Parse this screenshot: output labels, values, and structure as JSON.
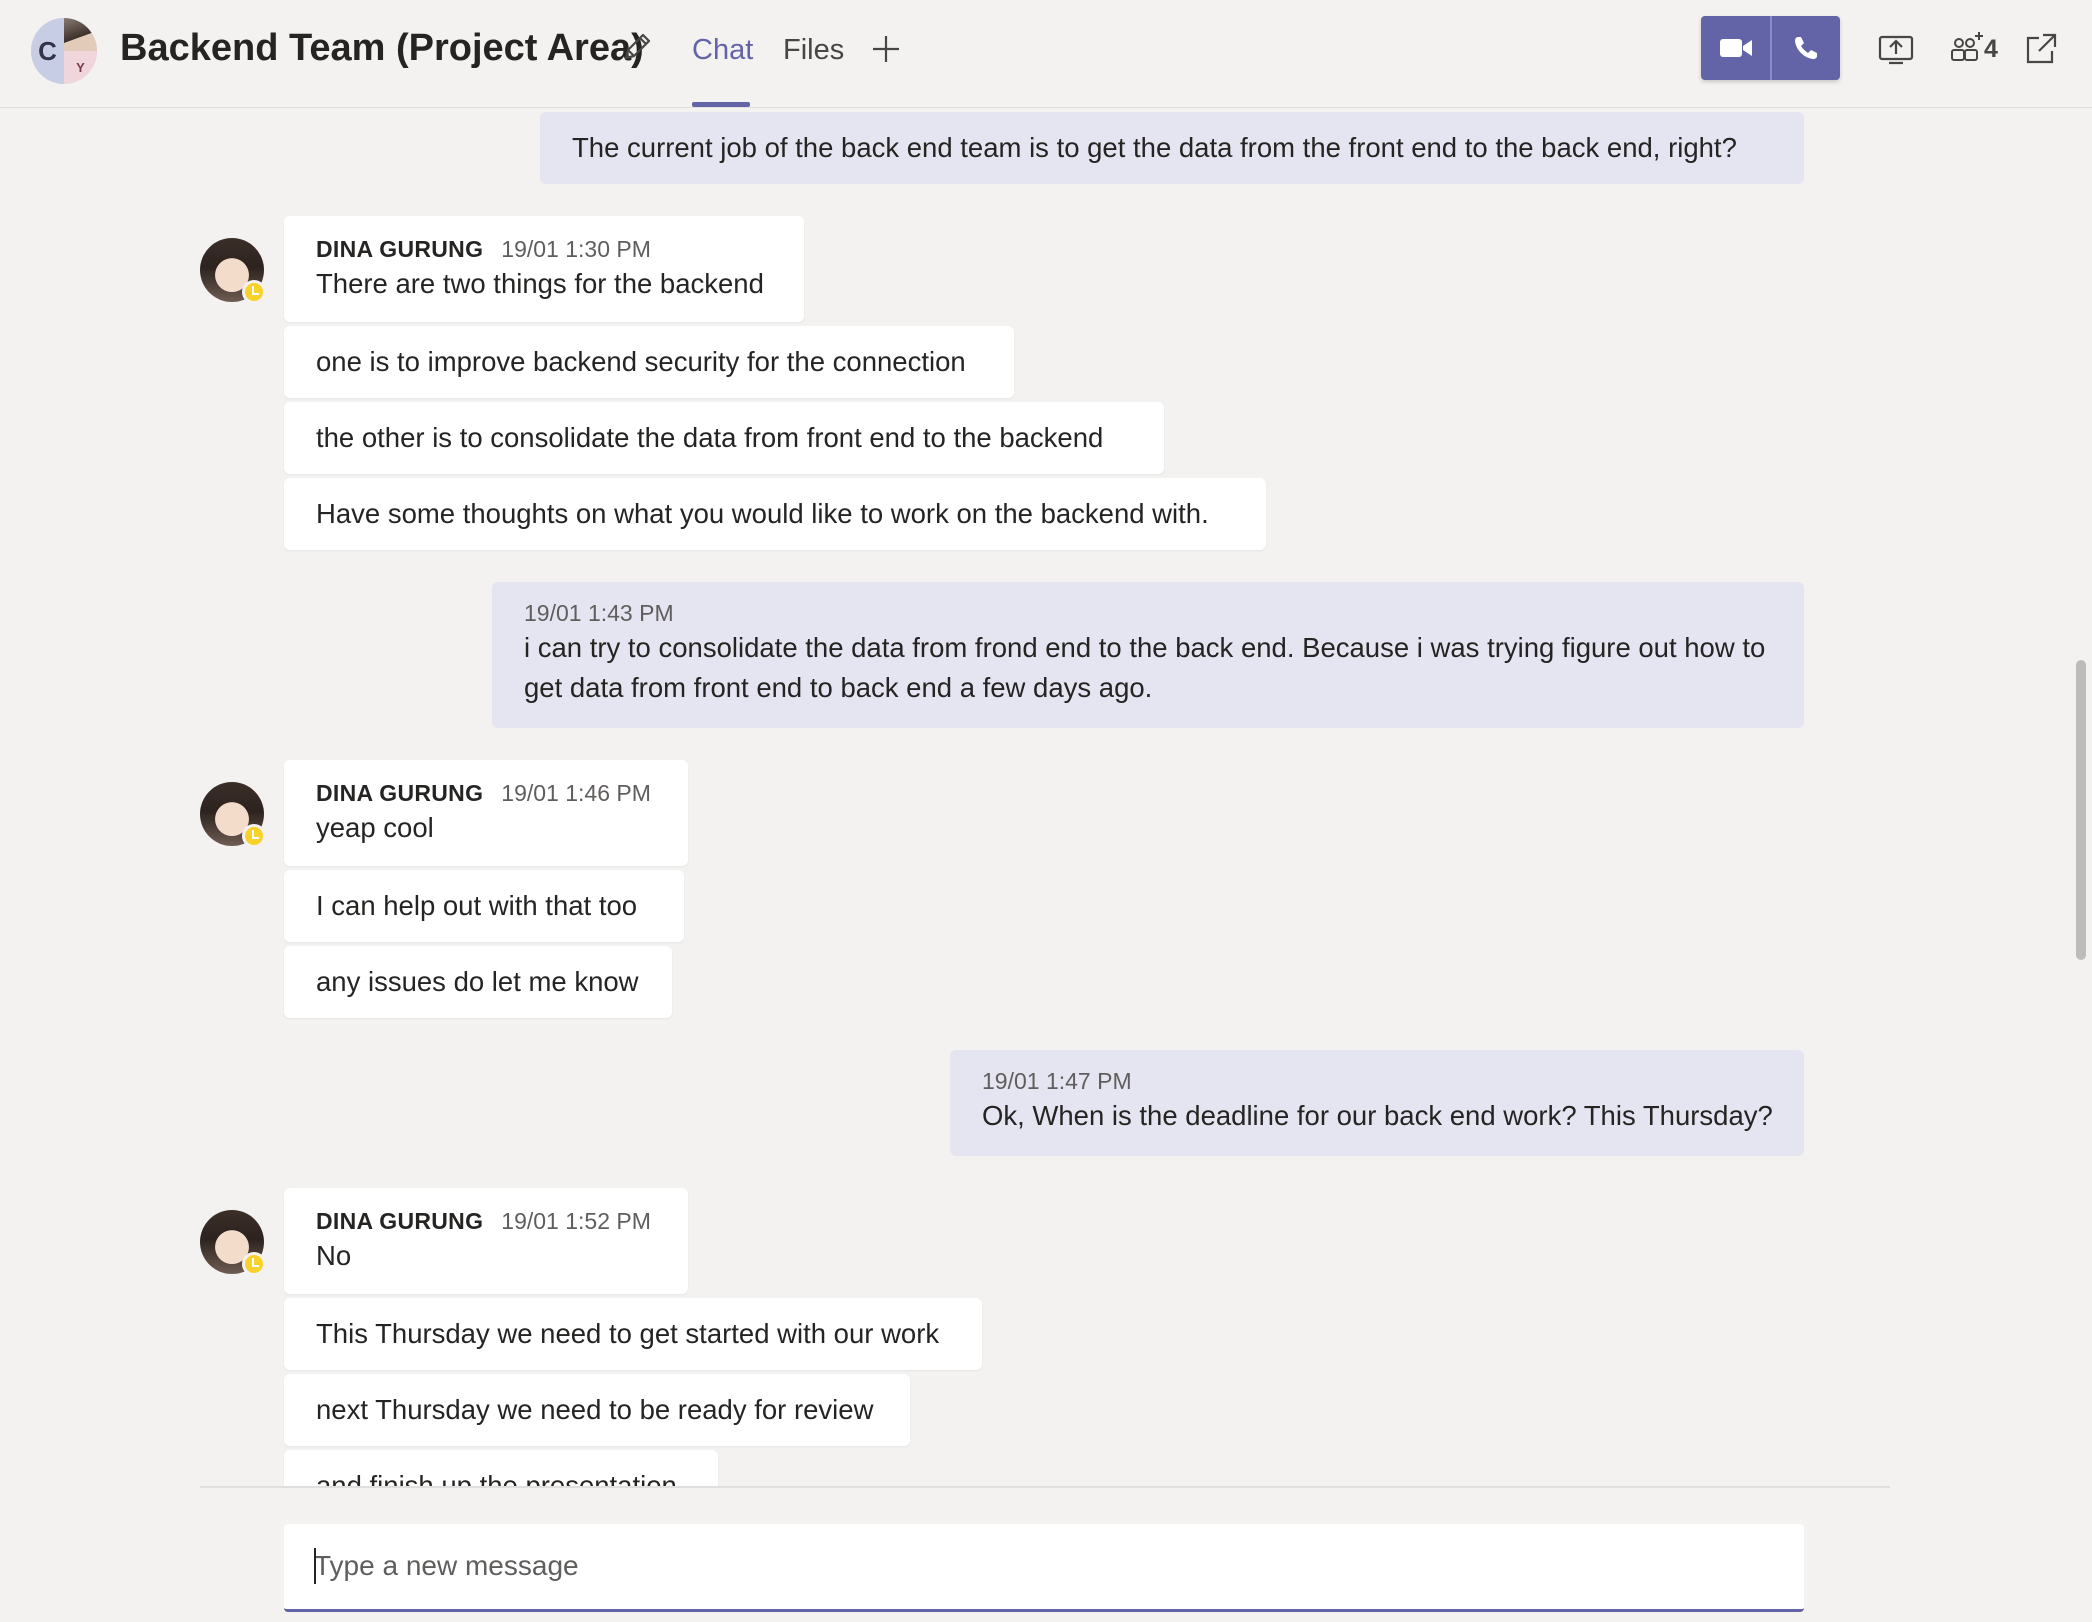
{
  "header": {
    "title": "Backend Team (Project Area)",
    "avatar_initial": "C",
    "avatar_sub_initial": "Y",
    "tabs": [
      {
        "label": "Chat",
        "active": true
      },
      {
        "label": "Files",
        "active": false
      }
    ],
    "participant_count": "4",
    "accent_color": "#6264a7"
  },
  "icons": {
    "edit": "pencil-icon",
    "add_tab": "plus-icon",
    "video_call": "video-camera-icon",
    "audio_call": "phone-icon",
    "share": "share-screen-icon",
    "participants": "add-people-icon",
    "pop_out": "pop-out-icon"
  },
  "messages": [
    {
      "id": "m1",
      "sent_by_me": true,
      "text": "The current job of the back end team is to get the data from the front end to the back end, right?"
    },
    {
      "id": "g1",
      "sent_by_me": false,
      "author": "DINA GURUNG",
      "time": "19/01 1:30 PM",
      "texts": [
        "There are two things for the backend",
        "one is to improve backend security for the connection",
        "the other is to consolidate the data from front end to the backend",
        "Have some thoughts on what you would like to work on the backend with."
      ]
    },
    {
      "id": "m2",
      "sent_by_me": true,
      "time": "19/01 1:43 PM",
      "text": "i can try to consolidate the data from frond end to the back end. Because i was trying figure out how to get data from front end to back end a few days ago."
    },
    {
      "id": "g2",
      "sent_by_me": false,
      "author": "DINA GURUNG",
      "time": "19/01 1:46 PM",
      "texts": [
        "yeap cool",
        "I can help out with that too",
        "any issues do let me know"
      ]
    },
    {
      "id": "m3",
      "sent_by_me": true,
      "time": "19/01 1:47 PM",
      "text": "Ok, When is the deadline for our back end work? This Thursday?"
    },
    {
      "id": "g3",
      "sent_by_me": false,
      "author": "DINA GURUNG",
      "time": "19/01 1:52 PM",
      "texts": [
        "No",
        "This Thursday we need to get started with our work",
        "next Thursday we need to be ready for review",
        "and finish up the presentation"
      ]
    }
  ],
  "compose": {
    "placeholder": "Type a new message"
  }
}
